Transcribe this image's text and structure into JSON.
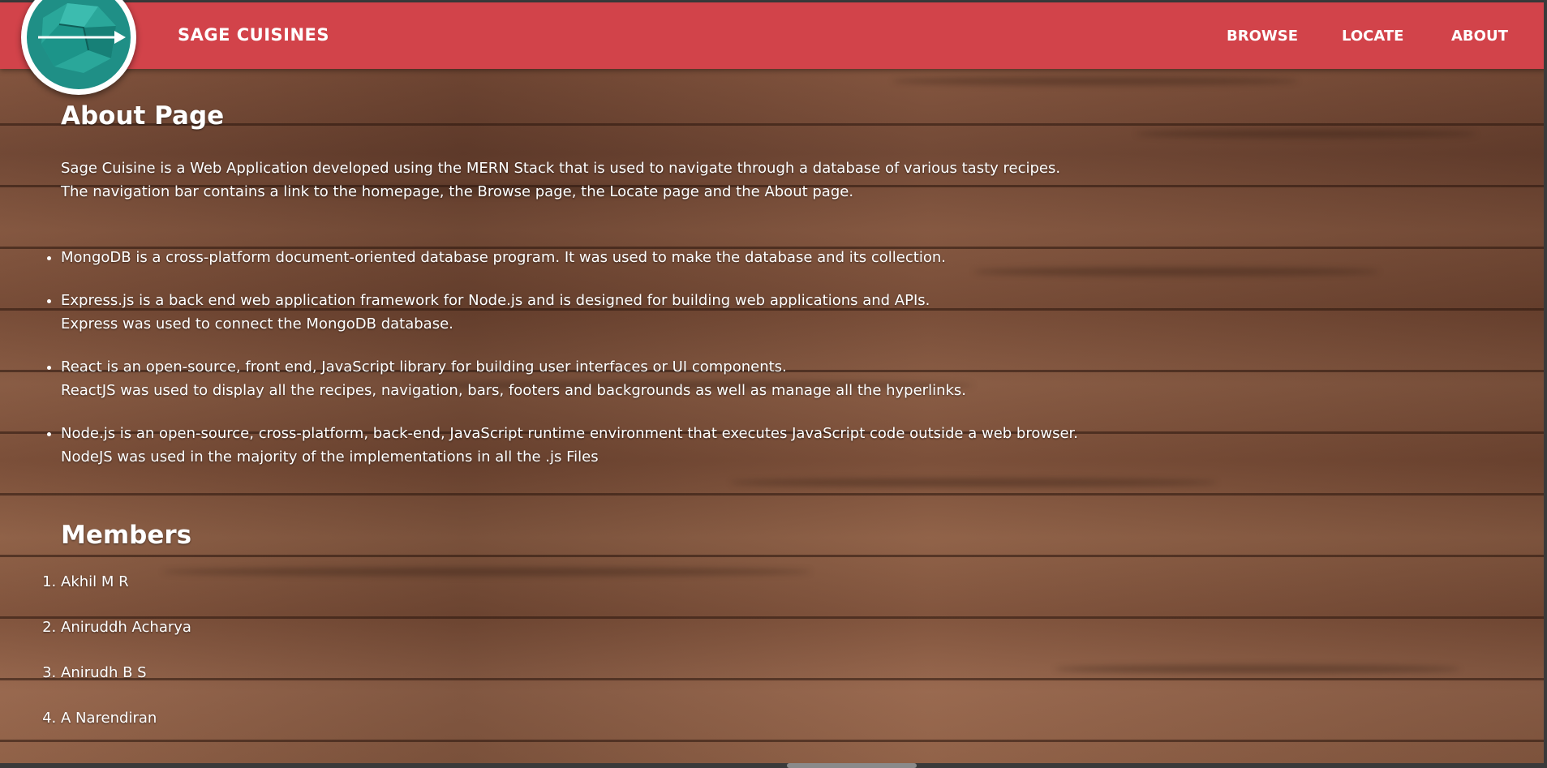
{
  "colors": {
    "navbar": "#d2434a",
    "text": "#ffffff",
    "logo_teal": "#1f8f86"
  },
  "nav": {
    "brand": "SAGE CUISINES",
    "links": [
      {
        "label": "BROWSE"
      },
      {
        "label": "LOCATE"
      },
      {
        "label": "ABOUT"
      }
    ],
    "logo_icon": "rock-arrow-logo-icon"
  },
  "about": {
    "title": "About Page",
    "intro_lines": [
      "Sage Cuisine is a Web Application developed using the MERN Stack that is used to navigate through a database of various tasty recipes.",
      "The navigation bar contains a link to the homepage, the Browse page, the Locate page and the About page."
    ],
    "tech": [
      {
        "line1": "MongoDB is a cross-platform document-oriented database program. It was used to make the database and its collection.",
        "line2": ""
      },
      {
        "line1": "Express.js is a back end web application framework for Node.js and is designed for building web applications and APIs.",
        "line2": "Express was used to connect the MongoDB database."
      },
      {
        "line1": "React is an open-source, front end, JavaScript library for building user interfaces or UI components.",
        "line2": "ReactJS was used to display all the recipes, navigation, bars, footers and backgrounds as well as manage all the hyperlinks."
      },
      {
        "line1": "Node.js is an open-source, cross-platform, back-end, JavaScript runtime environment that executes JavaScript code outside a web browser.",
        "line2": "NodeJS was used in the majority of the implementations in all the .js Files"
      }
    ]
  },
  "members": {
    "title": "Members",
    "names": [
      "Akhil M R",
      "Aniruddh Acharya",
      "Anirudh B S",
      "A Narendiran"
    ]
  }
}
